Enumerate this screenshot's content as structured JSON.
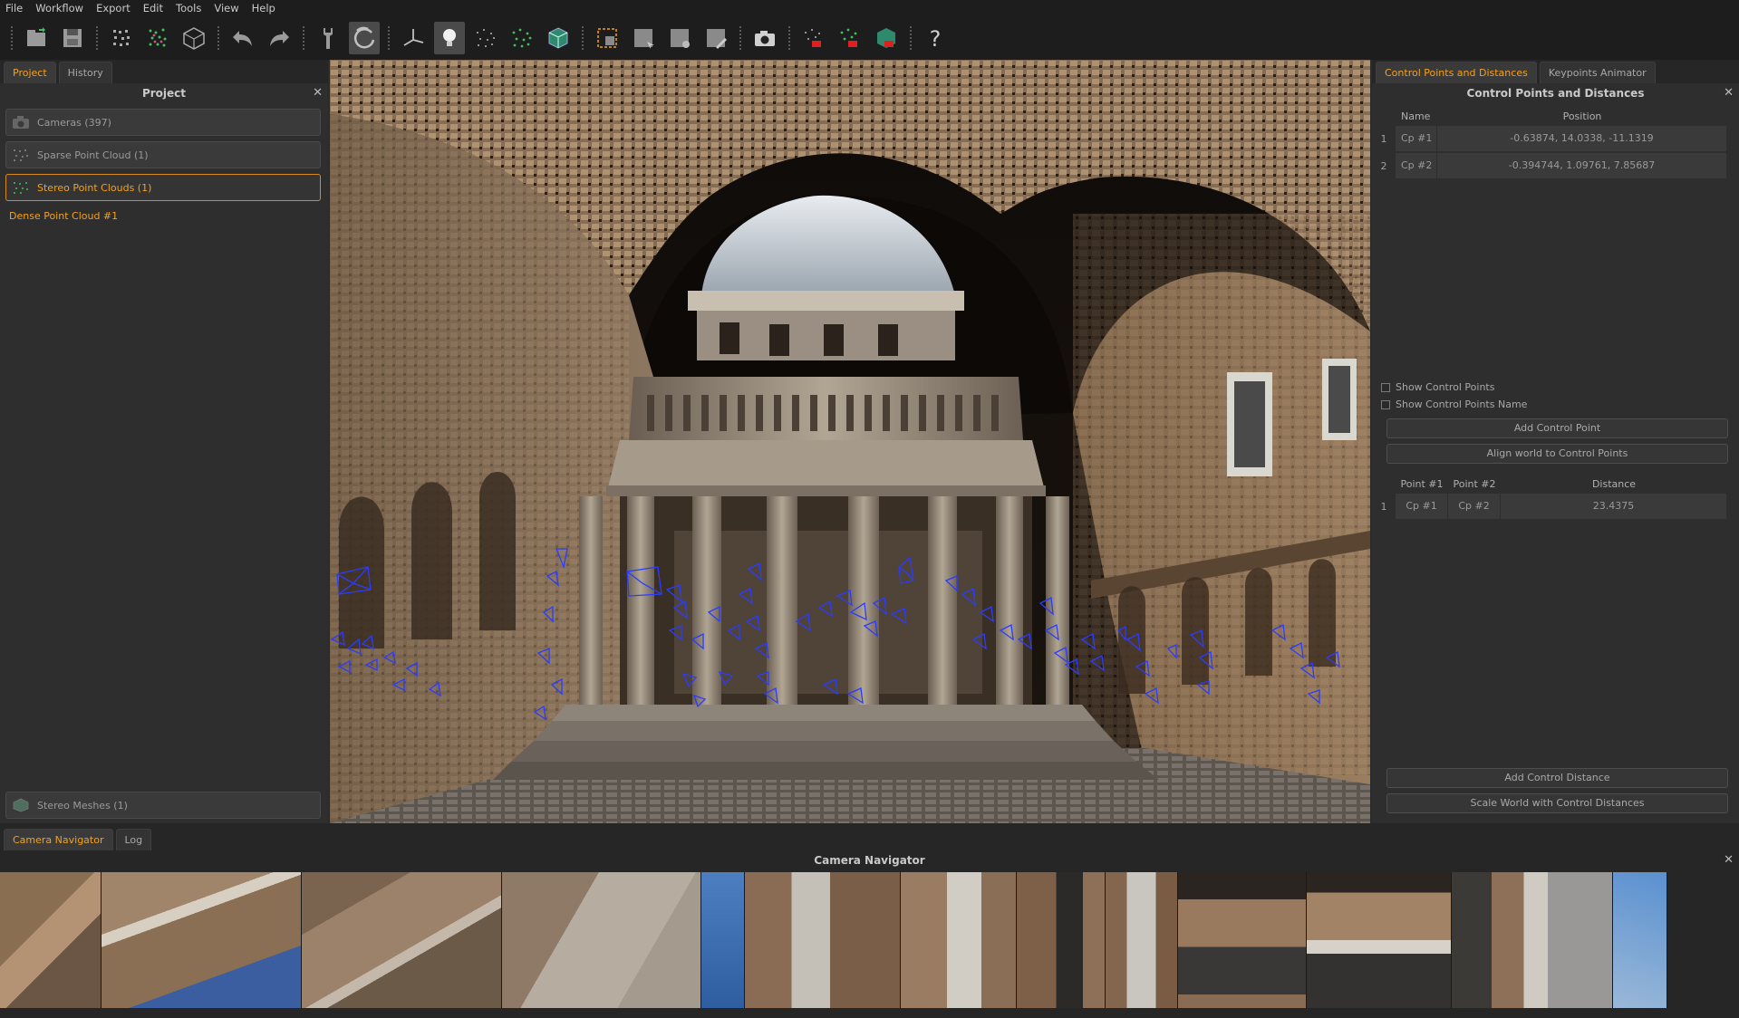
{
  "menu": [
    "File",
    "Workflow",
    "Export",
    "Edit",
    "Tools",
    "View",
    "Help"
  ],
  "toolbar": {
    "icons": [
      "new-project-icon",
      "save-icon",
      "sparse-cloud-icon",
      "dense-cloud-icon",
      "mesh-icon",
      "undo-icon",
      "redo-icon",
      "tools-icon",
      "orbit-icon",
      "axes-icon",
      "light-icon",
      "points-icon",
      "colored-points-icon",
      "box-icon",
      "select-region-icon",
      "select-box-icon",
      "select-lasso-icon",
      "select-paint-icon",
      "camera-icon",
      "remove-points-icon",
      "remove-colored-points-icon",
      "remove-box-icon",
      "help-icon"
    ]
  },
  "left": {
    "tabs": [
      "Project",
      "History"
    ],
    "title": "Project",
    "items": {
      "cameras": "Cameras (397)",
      "sparse": "Sparse Point Cloud (1)",
      "stereo": "Stereo Point Clouds (1)",
      "dense": "Dense Point Cloud #1",
      "meshes": "Stereo Meshes (1)"
    }
  },
  "right": {
    "tabs": [
      "Control Points and Distances",
      "Keypoints Animator"
    ],
    "title": "Control Points and Distances",
    "cp_headers": {
      "name": "Name",
      "position": "Position"
    },
    "control_points": [
      {
        "idx": "1",
        "name": "Cp #1",
        "position": "-0.63874, 14.0338, -11.1319"
      },
      {
        "idx": "2",
        "name": "Cp #2",
        "position": "-0.394744, 1.09761, 7.85687"
      }
    ],
    "show_cp": "Show Control Points",
    "show_cp_name": "Show Control Points Name",
    "add_cp": "Add Control Point",
    "align": "Align world to Control Points",
    "dist_headers": {
      "p1": "Point #1",
      "p2": "Point #2",
      "distance": "Distance"
    },
    "distances": [
      {
        "idx": "1",
        "p1": "Cp #1",
        "p2": "Cp #2",
        "distance": "23.4375"
      }
    ],
    "add_dist": "Add Control Distance",
    "scale": "Scale World with Control Distances"
  },
  "bottom": {
    "tabs": [
      "Camera Navigator",
      "Log"
    ],
    "title": "Camera Navigator"
  },
  "colors": {
    "accent": "#f5a11c",
    "camera_frustum": "#2a3cff"
  }
}
